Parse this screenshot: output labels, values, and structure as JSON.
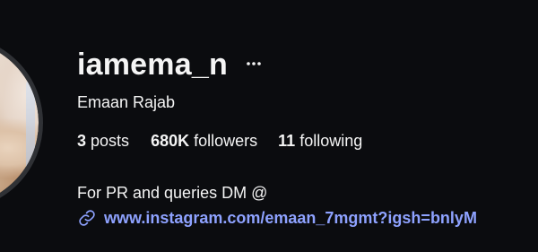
{
  "profile": {
    "username": "iamema_n",
    "full_name": "Emaan Rajab",
    "more_icon": "more-horizontal-icon",
    "avatar_icon": "profile-avatar"
  },
  "stats": {
    "posts_count": "3",
    "posts_label": "posts",
    "followers_count": "680K",
    "followers_label": "followers",
    "following_count": "11",
    "following_label": "following"
  },
  "bio": {
    "text": "For PR and queries DM @",
    "link_icon": "link-icon",
    "link_text": "www.instagram.com/emaan_7mgmt?igsh=bnlyM"
  },
  "colors": {
    "background": "#0b0c0f",
    "text": "#f5f5f5",
    "link": "#8ea2ff",
    "avatar_ring": "#2f3135"
  }
}
